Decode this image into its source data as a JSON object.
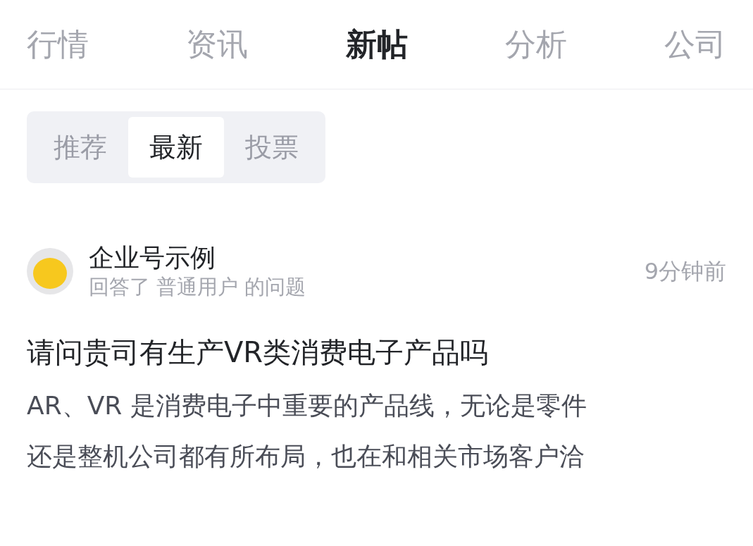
{
  "tabs": [
    {
      "label": "行情",
      "selected": false
    },
    {
      "label": "资讯",
      "selected": false
    },
    {
      "label": "新帖",
      "selected": true
    },
    {
      "label": "分析",
      "selected": false
    },
    {
      "label": "公司",
      "selected": false
    }
  ],
  "filters": [
    {
      "label": "推荐",
      "selected": false
    },
    {
      "label": "最新",
      "selected": true
    },
    {
      "label": "投票",
      "selected": false
    }
  ],
  "post": {
    "author": "企业号示例",
    "action": "回答了 普通用户 的问题",
    "time": "9分钟前",
    "title": "请问贵司有生产VR类消费电子产品吗",
    "body_lines": [
      "AR、VR 是消费电子中重要的产品线，无论是零件",
      "还是整机公司都有所布局，也在和相关市场客户洽"
    ]
  }
}
